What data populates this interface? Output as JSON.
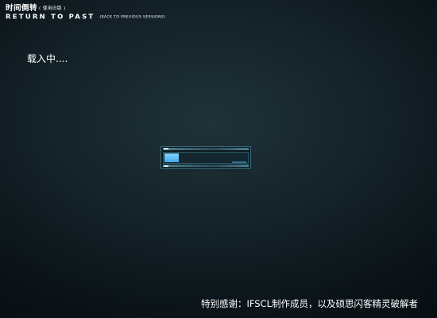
{
  "header": {
    "title_cn": "时间倒转",
    "title_cn_sub": "( 使用旧版 )",
    "title_en": "RETURN TO PAST",
    "title_en_sub": "(BACK TO PREVIOUS VERSIONS)"
  },
  "status": {
    "loading_text": "载入中...."
  },
  "progress": {
    "fraction": 0.17
  },
  "footer": {
    "credits": "特别感谢：IFSCL制作成员，以及硕思闪客精灵破解者"
  },
  "colors": {
    "progress_fill": "#5ab8f0",
    "frame_border": "#3d6e80"
  }
}
